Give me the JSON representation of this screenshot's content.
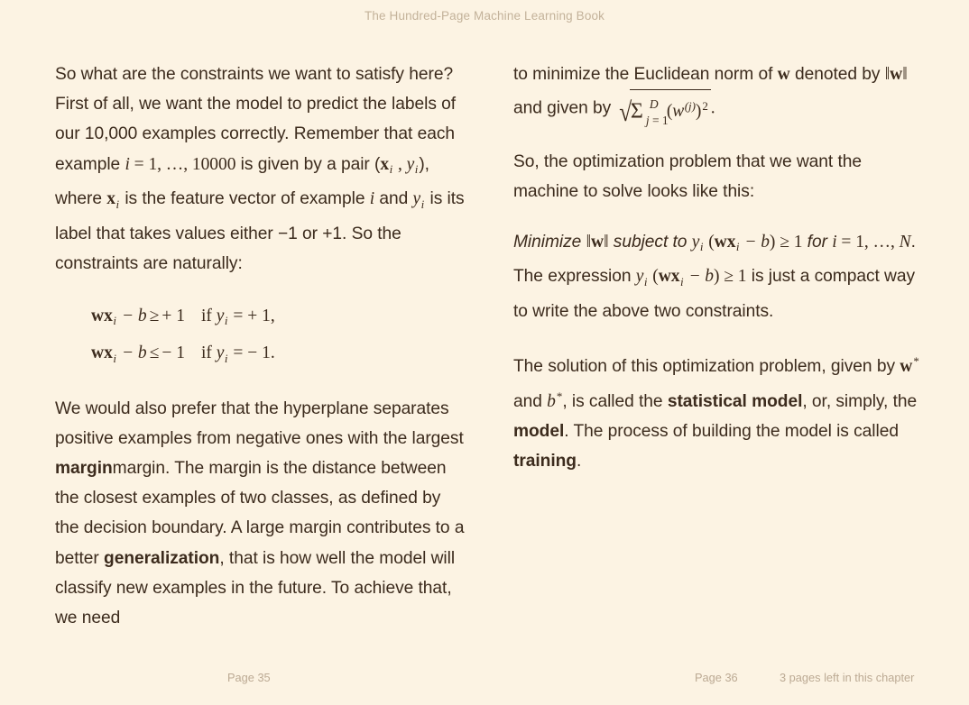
{
  "header": {
    "running_title": "The Hundred-Page Machine Learning Book"
  },
  "colors": {
    "page_background": "#fcf3e3",
    "body_text": "#3c2b1d",
    "header_text": "#c3b29a",
    "footer_text": "#bcaa94"
  },
  "left_column": {
    "paragraph_1": {
      "part_1": "So what are the constraints we want to satisfy here? First of all, we want the model to predict the labels of our 10,000 examples correctly. Remember that each example ",
      "math_i": "i",
      "eq_sign": " = ",
      "range": "1, …, 10000",
      "part_2": " is given by a pair (",
      "vec_x": "x",
      "sub_i_1": "i",
      "comma": " , ",
      "var_y": "y",
      "sub_i_2": "i",
      "part_3": "), where ",
      "vec_x_2": "x",
      "sub_i_3": "i",
      "part_4": " is the feature vector of example ",
      "math_i_2": "i",
      "part_5": " and ",
      "var_y_2": "y",
      "sub_i_4": "i",
      "part_6": " is its label that takes values either −1 or +1. So the constraints are naturally:"
    },
    "equations": [
      {
        "vec": "wx",
        "sub": "i",
        "minus_b": " − b",
        "relation": "≥",
        "value": "+ 1",
        "condition_if": "if ",
        "condition_var": "y",
        "condition_sub": "i",
        "condition_eq": " = ",
        "condition_value": "+ 1,"
      },
      {
        "vec": "wx",
        "sub": "i",
        "minus_b": " − b",
        "relation": "≤",
        "value": "− 1",
        "condition_if": "if ",
        "condition_var": "y",
        "condition_sub": "i",
        "condition_eq": " = ",
        "condition_value": "− 1."
      }
    ],
    "paragraph_2": {
      "part_1": "We would also prefer that the hyperplane separates positive examples from negative ones with the largest ",
      "bold_margin": "margin",
      "part_2": "margin. The margin is the distance between the closest examples of two classes, as defined by the decision boundary. A large margin contributes to a better ",
      "bold_generalization": "generalization",
      "part_3": ", that is how well the model will classify new examples in the future. To achieve that, we need"
    }
  },
  "right_column": {
    "paragraph_1": {
      "part_1": "to minimize the Euclidean norm of ",
      "vec_w": "w",
      "part_2": " denoted by ",
      "norm_w_open": "‖",
      "norm_w_var": "w",
      "norm_w_close": "‖",
      "part_3": " and given by ",
      "sqrt_sum_symbol": "Σ",
      "sum_upper": "D",
      "sum_lower_var": "j",
      "sum_lower_eq": " = ",
      "sum_lower_val": "1",
      "radicand_open": "(",
      "radicand_var": "w",
      "radicand_superscript": "(j)",
      "radicand_close": ")",
      "radicand_power": "2",
      "period": "."
    },
    "paragraph_2": {
      "text": "So, the optimization problem that we want the machine to solve looks like this:"
    },
    "paragraph_3": {
      "minimize": "Minimize ",
      "norm_open": "‖",
      "norm_var": "w",
      "norm_close": "‖",
      "subject_to": " subject to ",
      "var_y": "y",
      "sub_i": "i",
      "open_paren": " (",
      "vec_wx": "wx",
      "sub_i_2": "i",
      "minus_b": " − b",
      "close_paren": ")",
      "relation": " ≥ ",
      "one": "1",
      "for": " for ",
      "index_i": "i",
      "index_eq": " = ",
      "index_range": "1, …, ",
      "index_N": "N",
      "part_mid": ". The expression ",
      "var_y_2": "y",
      "sub_i_3": "i",
      "open_paren_2": " (",
      "vec_wx_2": "wx",
      "sub_i_4": "i",
      "minus_b_2": " − b",
      "close_paren_2": ")",
      "relation_2": " ≥ ",
      "one_2": "1",
      "part_end": " is just a compact way to write the above two constraints."
    },
    "paragraph_4": {
      "part_1": "The solution of this optimization problem, given by ",
      "vec_w_star": "w",
      "star_1": "*",
      "part_2": " and ",
      "var_b_star": "b",
      "star_2": "*",
      "part_3": ", is called the ",
      "bold_statistical_model": "statistical model",
      "part_4": ", or, simply, the ",
      "bold_model": "model",
      "part_5": ". The process of building the model is called ",
      "bold_training": "training",
      "part_6": "."
    }
  },
  "footer": {
    "page_left": "Page 35",
    "page_right": "Page 36",
    "chapter_progress": "3 pages left in this chapter"
  }
}
